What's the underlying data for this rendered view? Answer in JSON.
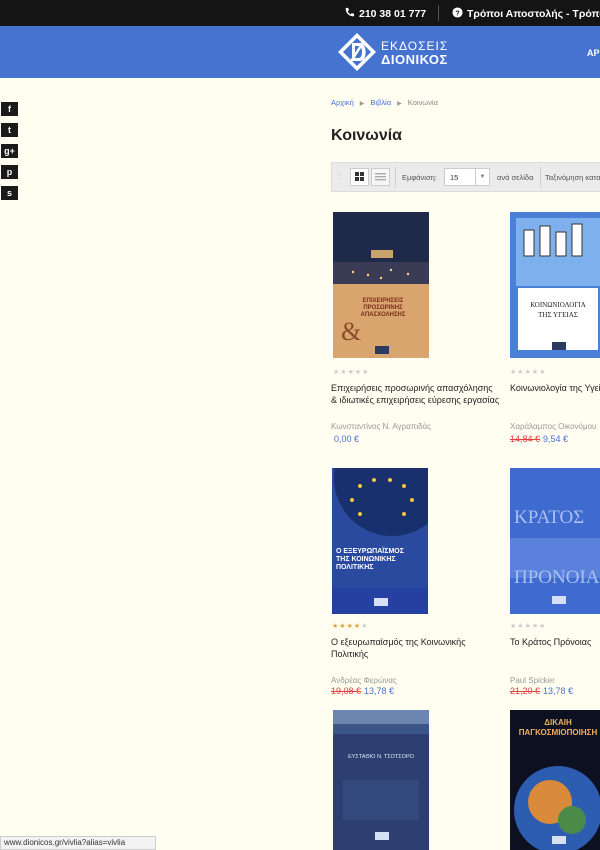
{
  "topbar": {
    "phone": "210 38 01 777",
    "shipping": "Τρόποι Αποστολής - Τρόποι"
  },
  "brand": {
    "line1": "ΕΚΔΟΣΕΙΣ",
    "line2": "ΔΙΟΝΙΚΟΣ",
    "color": "#4673d0"
  },
  "header": {
    "menu_first": "ΑΡ"
  },
  "social": [
    {
      "name": "facebook-icon",
      "glyph": "f"
    },
    {
      "name": "twitter-icon",
      "glyph": "t"
    },
    {
      "name": "google-plus-icon",
      "glyph": "g+"
    },
    {
      "name": "pinterest-icon",
      "glyph": "p"
    },
    {
      "name": "skype-icon",
      "glyph": "s"
    }
  ],
  "breadcrumb": {
    "home": "Αρχική",
    "books": "Βιβλία",
    "current": "Κοινωνία"
  },
  "page_title": "Κοινωνία",
  "toolbar": {
    "show_label": "Εμφάνιση:",
    "per_page_value": "15",
    "per_page_suffix": "ανά σελίδα",
    "sort_label": "Ταξινόμηση κατα"
  },
  "products": [
    {
      "title": "Επιχειρήσεις προσωρινής απασχόλησης & ιδιωτικές επιχειρήσεις εύρεσης εργασίας",
      "author": "Κωνσταντίνος Ν. Αγραπιδάς",
      "old_price": "",
      "price": "0,00 €",
      "rating": 0,
      "cover_text": [
        "ΕΠΙΧΕΙΡΗΣΕΙΣ",
        "ΠΡΟΣΩΡΙΝΗΣ",
        "ΑΠΑΣΧΟΛΗΣΗΣ"
      ]
    },
    {
      "title": "Κοινωνιολογία της Υγείας",
      "author": "Χαράλαμπος Οικονόμου",
      "old_price": "14,84 €",
      "price": "9,54 €",
      "rating": 0,
      "cover_text": [
        "ΚΟΙΝΩΝΙΟΛΟΓΙΑ",
        "ΤΗΣ ΥΓΕΙΑΣ"
      ]
    },
    {
      "title": "Ο εξευρωπαϊσμός της Κοινωνικής Πολιτικής",
      "author": "Ανδρέας Φερώνας",
      "old_price": "19,08 €",
      "price": "13,78 €",
      "rating": 4,
      "cover_text": [
        "Ο ΕΞΕΥΡΩΠΑΪΣΜΟΣ",
        "ΤΗΣ ΚΟΙΝΩΝΙΚΗΣ",
        "ΠΟΛΙΤΙΚΗΣ"
      ]
    },
    {
      "title": "Το Κράτος Πρόνοιας",
      "author": "Paul Spicker",
      "old_price": "21,20 €",
      "price": "13,78 €",
      "rating": 0,
      "cover_text": [
        "ΚΡΑΤΟΣ",
        "ΠΡΟΝΟΙΑΣ"
      ]
    },
    {
      "title": "",
      "author": "",
      "old_price": "",
      "price": "",
      "rating": 0,
      "cover_text": [
        "ΕΥΣΤΑΘΙΟ Ν. ΤΣΟΤΣΟΡΟ"
      ]
    },
    {
      "title": "",
      "author": "",
      "old_price": "",
      "price": "",
      "rating": 0,
      "cover_text": [
        "ΔΙΚΑΙΗ",
        "ΠΑΓΚΟΣΜΙΟΠΟΙΗΣΗ"
      ]
    }
  ],
  "status_url": "www.dionicos.gr/vivlia?alias=vivlia"
}
